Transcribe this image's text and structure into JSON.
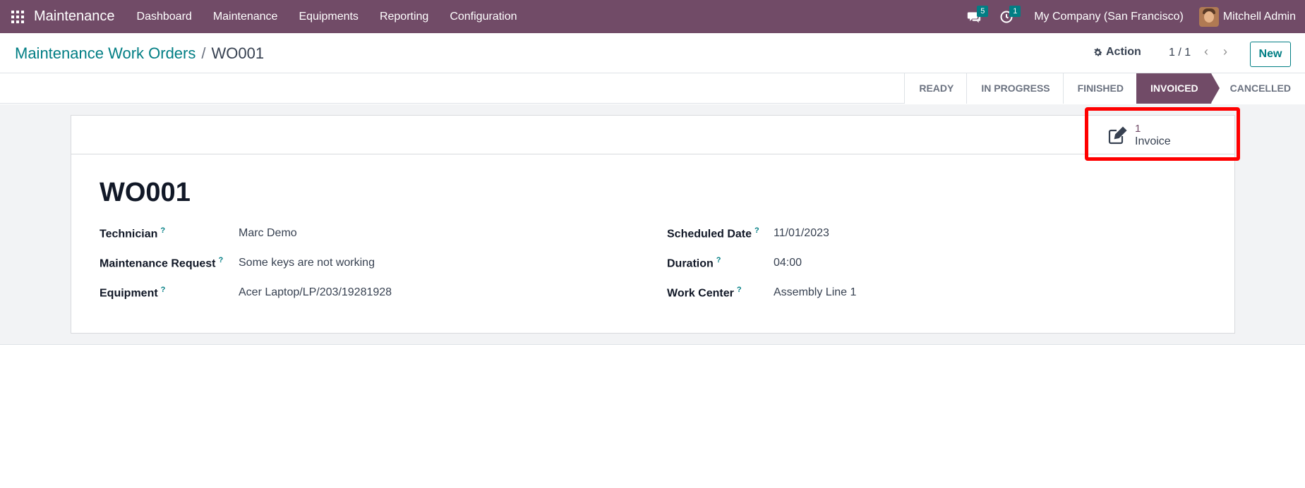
{
  "navbar": {
    "app_name": "Maintenance",
    "menu": [
      "Dashboard",
      "Maintenance",
      "Equipments",
      "Reporting",
      "Configuration"
    ],
    "messages_count": "5",
    "activities_count": "1",
    "company": "My Company (San Francisco)",
    "user": "Mitchell Admin",
    "accent_color": "#714b67",
    "badge_color": "#017e84"
  },
  "control_panel": {
    "breadcrumb_parent": "Maintenance Work Orders",
    "breadcrumb_sep": "/",
    "breadcrumb_current": "WO001",
    "action_label": "Action",
    "pager": "1 / 1",
    "new_label": "New"
  },
  "statusbar": {
    "steps": [
      "READY",
      "IN PROGRESS",
      "FINISHED",
      "INVOICED",
      "CANCELLED"
    ],
    "active": "INVOICED"
  },
  "smart_button": {
    "value": "1",
    "label": "Invoice",
    "icon": "edit-icon"
  },
  "form": {
    "title": "WO001",
    "help_mark": "?",
    "left_fields": [
      {
        "label": "Technician",
        "value": "Marc Demo"
      },
      {
        "label": "Maintenance Request",
        "value": "Some keys are not working"
      },
      {
        "label": "Equipment",
        "value": "Acer Laptop/LP/203/19281928"
      }
    ],
    "right_fields": [
      {
        "label": "Scheduled Date",
        "value": "11/01/2023"
      },
      {
        "label": "Duration",
        "value": "04:00"
      },
      {
        "label": "Work Center",
        "value": "Assembly Line 1"
      }
    ]
  },
  "highlight_color": "#ff0000"
}
